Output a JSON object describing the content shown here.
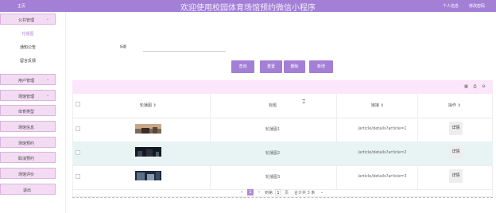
{
  "topbar": {
    "home": "主页",
    "title": "欢迎使用校园体育场馆预约微信小程序",
    "profile": "个人信息",
    "password": "修改密码"
  },
  "sidebar": {
    "public_mgmt": "公共管理",
    "sub_items": [
      "轮播图",
      "通知公告",
      "留言反馈"
    ],
    "menus": [
      "用户管理",
      "场馆管理",
      "体育类型",
      "场馆信息",
      "场馆预约",
      "取消预约",
      "场馆评价",
      "退出"
    ]
  },
  "search": {
    "label": "标题",
    "value": ""
  },
  "buttons": {
    "query": "查询",
    "reset": "重置",
    "delete": "删除",
    "add": "新增"
  },
  "toolbar_icons": [
    "grid-icon",
    "print-icon",
    "export-icon"
  ],
  "table": {
    "headers": [
      "轮播图",
      "标题",
      "链接",
      "操作"
    ],
    "rows": [
      {
        "title": "轮播图1",
        "link": "/article/details?article=1",
        "action": "详情"
      },
      {
        "title": "轮播图2",
        "link": "/article/details?article=2",
        "action": "详情"
      },
      {
        "title": "轮播图3",
        "link": "/article/details?article=3",
        "action": "详情"
      }
    ]
  },
  "pager": {
    "prev": "‹",
    "page": "1",
    "next": "›",
    "goto_label": "到第",
    "goto_value": "1",
    "page_unit": "页",
    "total": "合计共 3 条"
  },
  "colors": {
    "accent": "#a37fd6",
    "menu_bg": "#f3dcf3",
    "toolbar_bg": "#fbe6fb",
    "alt_row": "#e8f3f4"
  }
}
